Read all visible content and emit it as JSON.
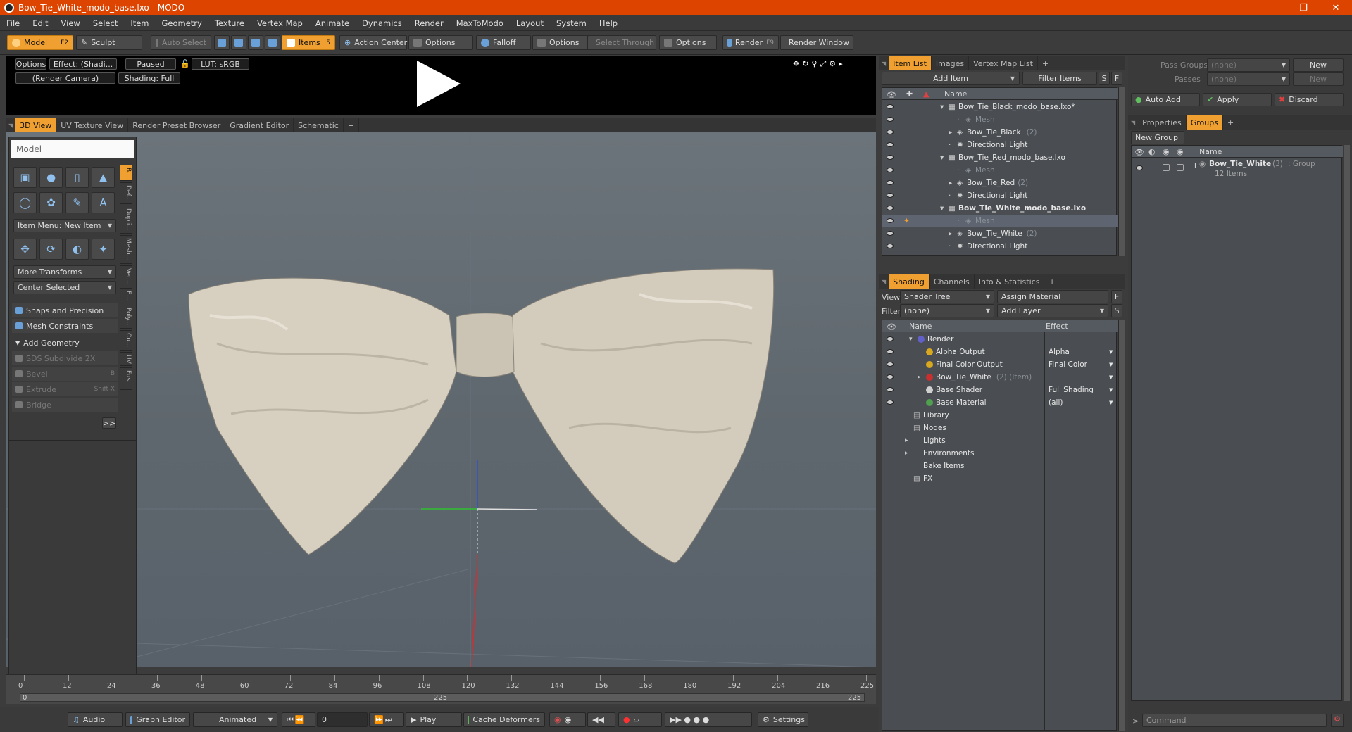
{
  "window": {
    "title": "Bow_Tie_White_modo_base.lxo - MODO"
  },
  "menu": [
    "File",
    "Edit",
    "View",
    "Select",
    "Item",
    "Geometry",
    "Texture",
    "Vertex Map",
    "Animate",
    "Dynamics",
    "Render",
    "MaxToModo",
    "Layout",
    "System",
    "Help"
  ],
  "toolbar": {
    "model": "Model",
    "model_key": "F2",
    "sculpt": "Sculpt",
    "auto_select": "Auto Select",
    "items": "Items",
    "items_key": "5",
    "action_center": "Action Center",
    "options": "Options",
    "falloff": "Falloff",
    "select_through": "Select Through",
    "render": "Render",
    "render_key": "F9",
    "render_window": "Render Window"
  },
  "preview": {
    "options": "Options",
    "effect": "Effect: (Shadi...",
    "paused": "Paused",
    "lut": "LUT: sRGB",
    "camera": "(Render Camera)",
    "shading": "Shading: Full"
  },
  "viewport_tabs": [
    "3D View",
    "UV Texture View",
    "Render Preset Browser",
    "Gradient Editor",
    "Schematic"
  ],
  "tools": {
    "panel_title": "Model",
    "item_menu": "Item Menu: New Item",
    "more_transforms": "More Transforms",
    "center_selected": "Center Selected",
    "snaps": "Snaps and Precision",
    "mesh_constraints": "Mesh Constraints",
    "add_geometry": "Add Geometry",
    "sds": "SDS Subdivide 2X",
    "bevel": "Bevel",
    "bevel_key": "B",
    "extrude": "Extrude",
    "extrude_key": "Shift-X",
    "bridge": "Bridge",
    "more": ">>",
    "side_tabs": [
      "B...",
      "Def...",
      "Dupli...",
      "Mesh...",
      "Ver...",
      "E...",
      "Poly...",
      "Cu...",
      "UV",
      "Fus..."
    ]
  },
  "timeline": {
    "ticks": [
      "0",
      "12",
      "24",
      "36",
      "48",
      "60",
      "72",
      "84",
      "96",
      "108",
      "120",
      "132",
      "144",
      "156",
      "168",
      "180",
      "192",
      "204",
      "216",
      "225"
    ],
    "start": "0",
    "mid": "225",
    "end": "225"
  },
  "bottom": {
    "audio": "Audio",
    "graph_editor": "Graph Editor",
    "animated": "Animated",
    "frame": "0",
    "play": "Play",
    "cache": "Cache Deformers",
    "settings": "Settings"
  },
  "item_list": {
    "tabs": [
      "Item List",
      "Images",
      "Vertex Map List"
    ],
    "add_item": "Add Item",
    "filter": "Filter Items",
    "s": "S",
    "f": "F",
    "col_name": "Name",
    "rows": [
      {
        "label": "Bow_Tie_Black_modo_base.lxo*",
        "indent": 0,
        "kind": "scene"
      },
      {
        "label": "Mesh",
        "indent": 2,
        "kind": "mesh"
      },
      {
        "label": "Bow_Tie_Black",
        "count": "(2)",
        "indent": 1,
        "kind": "group"
      },
      {
        "label": "Directional Light",
        "indent": 1,
        "kind": "light"
      },
      {
        "label": "Bow_Tie_Red_modo_base.lxo",
        "indent": 0,
        "kind": "scene"
      },
      {
        "label": "Mesh",
        "indent": 2,
        "kind": "mesh"
      },
      {
        "label": "Bow_Tie_Red",
        "count": "(2)",
        "indent": 1,
        "kind": "group"
      },
      {
        "label": "Directional Light",
        "indent": 1,
        "kind": "light"
      },
      {
        "label": "Bow_Tie_White_modo_base.lxo",
        "indent": 0,
        "kind": "scene",
        "bold": true
      },
      {
        "label": "Mesh",
        "indent": 2,
        "kind": "mesh",
        "selected": true
      },
      {
        "label": "Bow_Tie_White",
        "count": "(2)",
        "indent": 1,
        "kind": "group"
      },
      {
        "label": "Directional Light",
        "indent": 1,
        "kind": "light"
      }
    ]
  },
  "shading": {
    "tabs": [
      "Shading",
      "Channels",
      "Info & Statistics"
    ],
    "view_label": "View",
    "view_value": "Shader Tree",
    "assign": "Assign Material",
    "filter_label": "Filter",
    "filter_value": "(none)",
    "add_layer": "Add Layer",
    "col_name": "Name",
    "col_effect": "Effect",
    "rows": [
      {
        "label": "Render",
        "effect": "",
        "indent": 0,
        "color": "#6060c8"
      },
      {
        "label": "Alpha Output",
        "effect": "Alpha",
        "indent": 1,
        "color": "#d8a820"
      },
      {
        "label": "Final Color Output",
        "effect": "Final Color",
        "indent": 1,
        "color": "#d8a820"
      },
      {
        "label": "Bow_Tie_White",
        "suffix": "(2) (Item)",
        "effect": "",
        "indent": 1,
        "color": "#c83030"
      },
      {
        "label": "Base Shader",
        "effect": "Full Shading",
        "indent": 1,
        "color": "#d0d0d0"
      },
      {
        "label": "Base Material",
        "effect": "(all)",
        "indent": 1,
        "color": "#50a050"
      },
      {
        "label": "Library",
        "effect": "",
        "indent": 0,
        "color": ""
      },
      {
        "label": "Nodes",
        "effect": "",
        "indent": 0,
        "color": ""
      },
      {
        "label": "Lights",
        "effect": "",
        "indent": 0,
        "color": ""
      },
      {
        "label": "Environments",
        "effect": "",
        "indent": 0,
        "color": ""
      },
      {
        "label": "Bake Items",
        "effect": "",
        "indent": 0,
        "color": ""
      },
      {
        "label": "FX",
        "effect": "",
        "indent": 0,
        "color": ""
      }
    ]
  },
  "right": {
    "pass_groups": "Pass Groups",
    "passes": "Passes",
    "none": "(none)",
    "new": "New",
    "auto_add": "Auto Add",
    "apply": "Apply",
    "discard": "Discard",
    "tabs": [
      "Properties",
      "Groups"
    ],
    "new_group": "New Group",
    "col_name": "Name",
    "group_name": "Bow_Tie_White",
    "group_count": "(3)",
    "group_type": ": Group",
    "group_items": "12 Items",
    "command": "Command"
  },
  "colors": {
    "accent": "#f0a030",
    "title": "#dd4400"
  }
}
